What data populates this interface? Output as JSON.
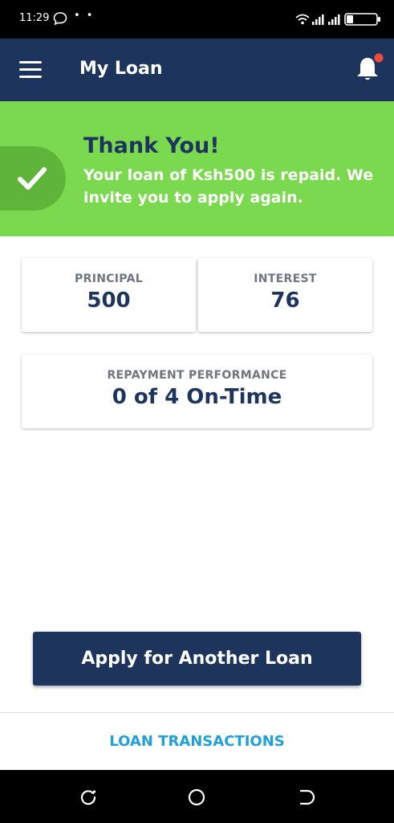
{
  "status_bar": {
    "time": "11:29",
    "dots": "• •",
    "icons": [
      "chat-bubble-icon",
      "wifi-icon",
      "signal-icon",
      "battery-icon"
    ]
  },
  "app_bar": {
    "title": "My Loan",
    "menu_icon": "hamburger-menu-icon",
    "bell_icon": "notification-bell-icon",
    "badge_color": "#ee4b3d"
  },
  "banner": {
    "title": "Thank You!",
    "message": "Your loan of Ksh500 is repaid. We invite you to apply again.",
    "icon": "checkmark-icon",
    "background": "#7ad94e"
  },
  "stats": {
    "principal": {
      "label": "PRINCIPAL",
      "value": "500"
    },
    "interest": {
      "label": "INTEREST",
      "value": "76"
    },
    "performance": {
      "label": "REPAYMENT PERFORMANCE",
      "value": "0 of 4 On-Time"
    }
  },
  "actions": {
    "apply_label": "Apply for Another Loan",
    "transactions_label": "LOAN TRANSACTIONS"
  },
  "nav": {
    "icons": [
      "recent-apps-icon",
      "home-icon",
      "back-icon"
    ]
  },
  "colors": {
    "primary": "#1d355c",
    "success": "#7ad94e",
    "link": "#20a0d8"
  }
}
